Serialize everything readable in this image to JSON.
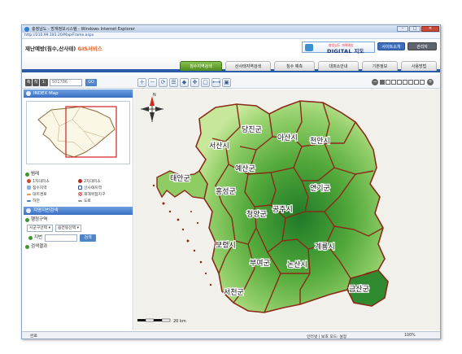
{
  "window": {
    "title": "충청남도 - 방재정보시스템 - Windows Internet Explorer",
    "address": "http://210.99.181.20/Map/Frame.aspx",
    "controls": {
      "min": "–",
      "max": "□",
      "close": "✕"
    }
  },
  "header": {
    "brand_main": "재난예방(침수,산사태) ",
    "brand_accent": "GIS서비스",
    "dmap_sub": "충청남도 재해예방",
    "dmap_title": "DIGITAL 지도",
    "site_button": "사이트소개",
    "admin_button": "관리자"
  },
  "menu": {
    "tabs": [
      {
        "label": "침수지역검색",
        "active": true
      },
      {
        "label": "산사태지역검색",
        "active": false
      },
      {
        "label": "침수 예측",
        "active": false
      },
      {
        "label": "대피소안내",
        "active": false
      },
      {
        "label": "기본정보",
        "active": false
      },
      {
        "label": "사용방법",
        "active": false
      }
    ]
  },
  "toolbar": {
    "scale_labels": [
      "축",
      "척",
      "1:"
    ],
    "scale_value": "501786",
    "go_label": "GO",
    "tools": [
      {
        "icon": "zoom-in-icon",
        "glyph": "＋"
      },
      {
        "icon": "zoom-out-icon",
        "glyph": "－"
      },
      {
        "icon": "refresh-icon",
        "glyph": "⟳"
      },
      {
        "icon": "layer-icon",
        "glyph": "☰"
      },
      {
        "icon": "fill-icon",
        "glyph": "◆"
      },
      {
        "icon": "pan-icon",
        "glyph": "✥"
      },
      {
        "icon": "fullscreen-icon",
        "glyph": "▢"
      },
      {
        "icon": "measure-icon",
        "glyph": "⟷"
      },
      {
        "icon": "print-icon",
        "glyph": "▣"
      }
    ],
    "zoom_minus": "−",
    "zoom_plus": "+",
    "zoom_level": 1,
    "zoom_steps": 8
  },
  "sidebar": {
    "index_map_title": "INDEX Map",
    "legend_title": "범례",
    "legend": [
      {
        "label": "1차대피소",
        "color": "#d8462b"
      },
      {
        "label": "2차대피소",
        "color": "#b92d1f"
      },
      {
        "label": "침수지역",
        "color": "#7fb6e8"
      },
      {
        "label": "산사태지역",
        "color": "#2e4fa3"
      },
      {
        "label": "대피경로",
        "color": "#e39a3c"
      },
      {
        "label": "재해위험지구",
        "color": "#cc3a2a"
      },
      {
        "label": "하천",
        "color": "#3d7fd0"
      },
      {
        "label": "도로",
        "color": "#9a9a9a"
      }
    ],
    "search_title": "지명지번검색",
    "admin_label": "행정구역",
    "sigungu": "시군구선택",
    "eupmyeon": "읍면동선택",
    "jibun_label": "지번",
    "search_button": "검색",
    "result_label": "검색결과"
  },
  "map": {
    "north_label": "N",
    "scalebar_label": "20 km",
    "labels": [
      {
        "text": "당진군"
      },
      {
        "text": "서산시"
      },
      {
        "text": "아산시"
      },
      {
        "text": "천안시"
      },
      {
        "text": "태안군"
      },
      {
        "text": "예산군"
      },
      {
        "text": "홍성군"
      },
      {
        "text": "연기군"
      },
      {
        "text": "공주시"
      },
      {
        "text": "청양군"
      },
      {
        "text": "보령시"
      },
      {
        "text": "계룡시"
      },
      {
        "text": "부여군"
      },
      {
        "text": "논산시"
      },
      {
        "text": "서천군"
      },
      {
        "text": "금산군"
      }
    ]
  },
  "status": {
    "done": "완료",
    "zone": "인터넷 | 보호 모드: 설정",
    "zoom": "100%"
  }
}
